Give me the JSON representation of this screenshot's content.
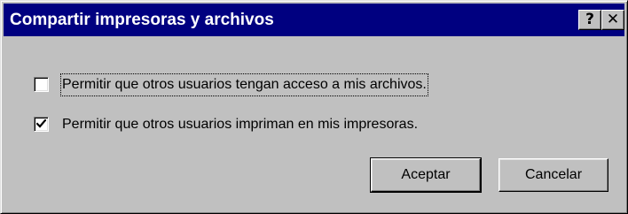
{
  "window": {
    "title": "Compartir impresoras y archivos",
    "help_label": "?",
    "close_label": "✕"
  },
  "options": [
    {
      "label": "Permitir que otros usuarios tengan acceso a mis archivos.",
      "checked": false
    },
    {
      "label": "Permitir que otros usuarios impriman en mis impresoras.",
      "checked": true
    }
  ],
  "buttons": {
    "ok_label": "Aceptar",
    "cancel_label": "Cancelar"
  }
}
